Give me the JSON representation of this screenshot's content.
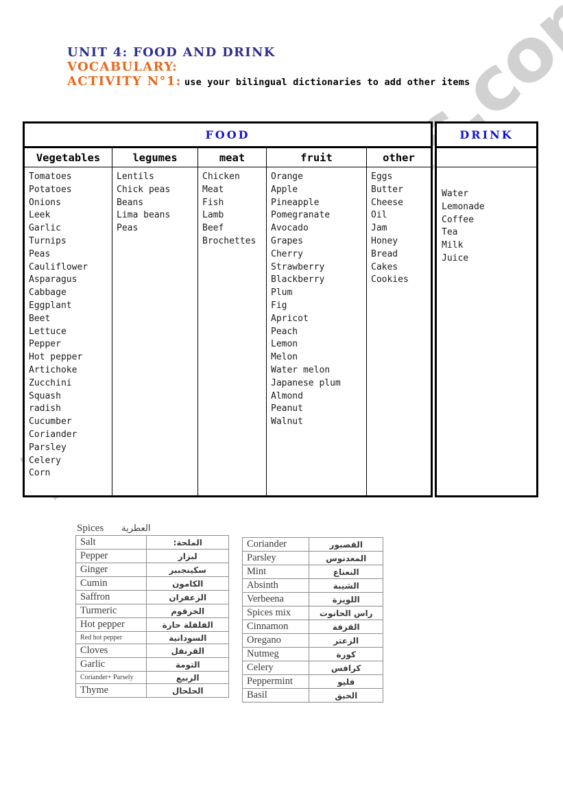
{
  "heading": {
    "unit_title": "UNIT 4: FOOD AND DRINK",
    "vocabulary_label": "VOCABULARY:",
    "activity_label": "ACTIVITY N°1:",
    "activity_instruction": "use your bilingual dictionaries to add other items"
  },
  "watermark": {
    "text": "ESLprintables.com",
    "color": "#c9c9c9"
  },
  "colors": {
    "unit_title": "#2f2f8f",
    "vocabulary": "#e8671a",
    "activity": "#e8671a",
    "band_title": "#1414cc",
    "table_border": "#000000"
  },
  "main_table": {
    "food_band_title": "FOOD",
    "drink_band_title": "DRINK",
    "columns": [
      {
        "header": "Vegetables",
        "items": [
          "Tomatoes",
          "Potatoes",
          "Onions",
          "Leek",
          "Garlic",
          "Turnips",
          "Peas",
          "Cauliflower",
          "Asparagus",
          "Cabbage",
          "Eggplant",
          "Beet",
          "Lettuce",
          "Pepper",
          "Hot pepper",
          "Artichoke",
          "Zucchini",
          "Squash",
          "radish",
          "Cucumber",
          "Coriander",
          "Parsley",
          "Celery",
          "Corn"
        ]
      },
      {
        "header": "legumes",
        "items": [
          "Lentils",
          "Chick peas",
          "Beans",
          "Lima beans",
          "Peas"
        ]
      },
      {
        "header": "meat",
        "items": [
          "Chicken",
          "Meat",
          "Fish",
          "Lamb",
          "Beef",
          "Brochettes"
        ]
      },
      {
        "header": "fruit",
        "items": [
          "Orange",
          "Apple",
          "Pineapple",
          "Pomegranate",
          "Avocado",
          "Grapes",
          "Cherry",
          "Strawberry",
          "Blackberry",
          "Plum",
          "Fig",
          "Apricot",
          "Peach",
          "Lemon",
          "Melon",
          "Water melon",
          "Japanese plum",
          "Almond",
          "Peanut",
          "Walnut"
        ]
      },
      {
        "header": "other",
        "items": [
          "Eggs",
          "Butter",
          "Cheese",
          "Oil",
          "Jam",
          "Honey",
          "Bread",
          "Cakes",
          "Cookies"
        ]
      }
    ],
    "drink_column": {
      "header": "",
      "items": [
        "Water",
        "Lemonade",
        "Coffee",
        "Tea",
        "Milk",
        "Juice"
      ]
    }
  },
  "spices": {
    "label_en": "Spices",
    "label_ar": "العطرية",
    "left_table": [
      {
        "en": "Salt",
        "ar": "الملحة:"
      },
      {
        "en": "Pepper",
        "ar": "لبزار"
      },
      {
        "en": "Ginger",
        "ar": "سكينجبير"
      },
      {
        "en": "Cumin",
        "ar": "الكامون"
      },
      {
        "en": "Saffron",
        "ar": "الزعفران"
      },
      {
        "en": "Turmeric",
        "ar": "الخرقوم"
      },
      {
        "en": "Hot pepper",
        "ar": "الفلفلة حارة"
      },
      {
        "en": "Red hot pepper",
        "ar": "السودانية",
        "small": true
      },
      {
        "en": "Cloves",
        "ar": "القرنفل"
      },
      {
        "en": "Garlic",
        "ar": "التومة"
      },
      {
        "en": "Coriander+ Parsely",
        "ar": "الربيع",
        "small": true
      },
      {
        "en": "Thyme",
        "ar": "الحلحال"
      }
    ],
    "right_table": [
      {
        "en": "Coriander",
        "ar": "القصبور"
      },
      {
        "en": "Parsley",
        "ar": "المعدنوس"
      },
      {
        "en": "Mint",
        "ar": "النعناع"
      },
      {
        "en": "Absinth",
        "ar": "الشيبة"
      },
      {
        "en": "Verbeena",
        "ar": "اللويزة"
      },
      {
        "en": "Spices mix",
        "ar": "راس الحانوت"
      },
      {
        "en": "Cinnamon",
        "ar": "القرفة"
      },
      {
        "en": "Oregano",
        "ar": "الزعتر"
      },
      {
        "en": "Nutmeg",
        "ar": "كوزة"
      },
      {
        "en": "Celery",
        "ar": "كرافس"
      },
      {
        "en": "Peppermint",
        "ar": "فليو"
      },
      {
        "en": "Basil",
        "ar": "الحبق"
      }
    ]
  }
}
